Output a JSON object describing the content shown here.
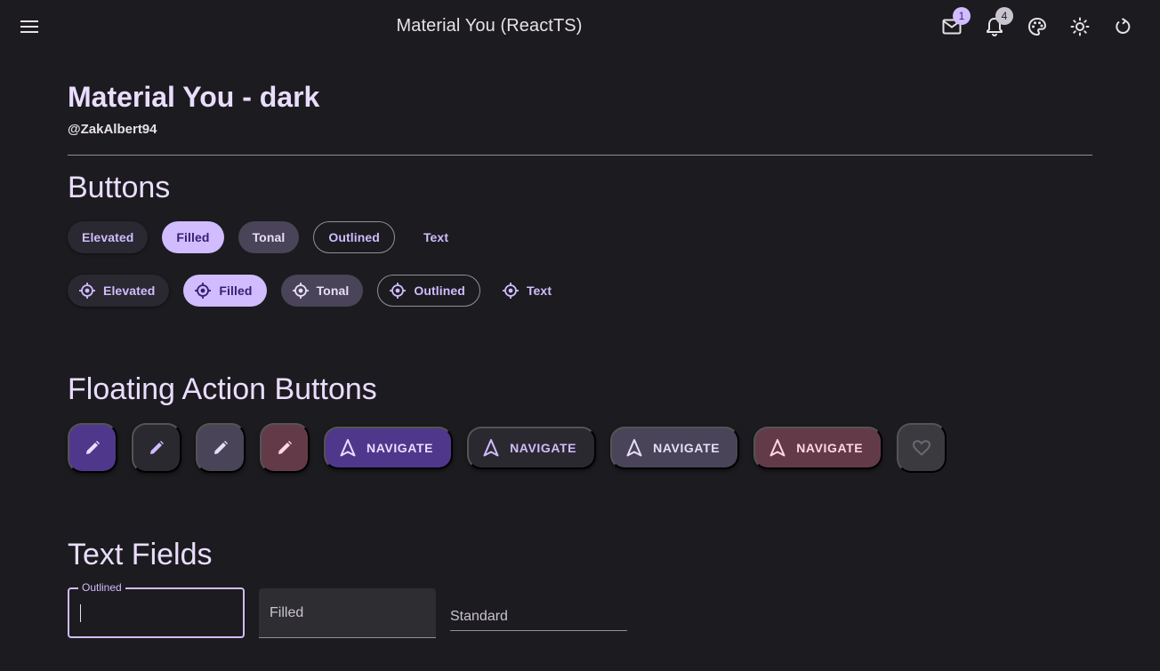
{
  "appbar": {
    "title": "Material You (ReactTS)",
    "menu_icon": "menu-icon",
    "actions": [
      {
        "icon": "mail-icon",
        "badge": "1"
      },
      {
        "icon": "bell-icon",
        "badge": "4"
      },
      {
        "icon": "palette-icon"
      },
      {
        "icon": "sun-icon"
      },
      {
        "icon": "restart-icon"
      }
    ]
  },
  "header": {
    "title": "Material You - dark",
    "subtitle": "@ZakAlbert94"
  },
  "sections": {
    "buttons": "Buttons",
    "fabs": "Floating Action Buttons",
    "text_fields": "Text Fields"
  },
  "buttons": {
    "row1": [
      "Elevated",
      "Filled",
      "Tonal",
      "Outlined",
      "Text"
    ],
    "row2": [
      "Elevated",
      "Filled",
      "Tonal",
      "Outlined",
      "Text"
    ],
    "row2_icon": "target-icon"
  },
  "fabs": {
    "navigate_label": "NAVIGATE",
    "edit_icon": "pencil-icon",
    "navigate_icon": "navigation-arrow-icon",
    "disabled_icon": "heart-icon"
  },
  "text_fields": {
    "outlined_label": "Outlined",
    "filled_label": "Filled",
    "standard_label": "Standard"
  },
  "colors": {
    "background": "#1c1b1f",
    "primary": "#d0bcff",
    "on_primary": "#381e72",
    "primary_container": "#4f378b",
    "secondary_container": "#4a4458",
    "tertiary_container": "#633b48",
    "outline": "#938f99"
  }
}
